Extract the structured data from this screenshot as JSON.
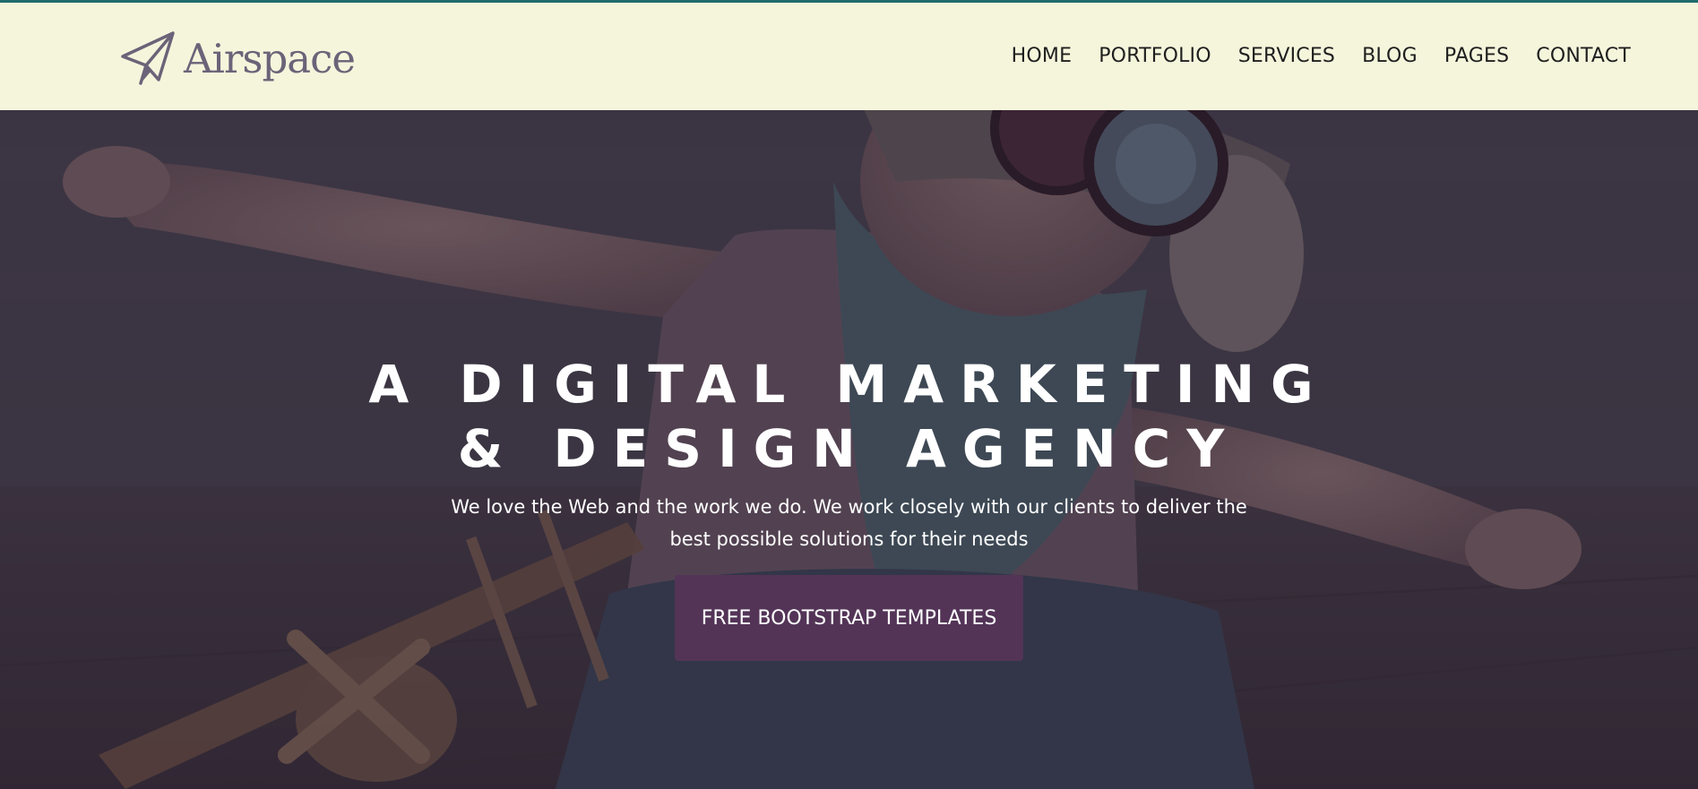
{
  "brand": {
    "name": "Airspace",
    "icon": "paper-plane-icon"
  },
  "nav": {
    "items": [
      {
        "label": "HOME"
      },
      {
        "label": "PORTFOLIO"
      },
      {
        "label": "SERVICES"
      },
      {
        "label": "BLOG"
      },
      {
        "label": "PAGES"
      },
      {
        "label": "CONTACT"
      }
    ]
  },
  "hero": {
    "title_line1": "A DIGITAL MARKETING",
    "title_line2": "& DESIGN AGENCY",
    "subtitle": "We love the Web and the work we do. We work closely with our clients to deliver the best possible solutions for their needs",
    "button_label": "FREE BOOTSTRAP TEMPLATES"
  },
  "colors": {
    "accent_line": "#1f6b6b",
    "navbar_bg": "#f5f5dc",
    "brand_text": "#6b6378",
    "button_bg": "#533457"
  }
}
